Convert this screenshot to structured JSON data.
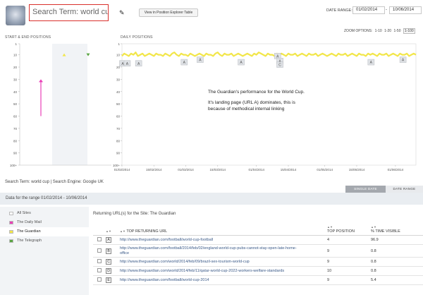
{
  "header": {
    "search_term": "Search Term: world cup",
    "explorer_button": "View in Position Explorer Table",
    "date_range_label": "DATE RANGE:",
    "date_from": "01/02/2014",
    "date_to": "10/06/2014",
    "date_separator": "-"
  },
  "zoom": {
    "label": "ZOOM OPTIONS:",
    "options": [
      "1-10",
      "1-20",
      "1-50",
      "1-100"
    ],
    "active_option": "1-100"
  },
  "panels": {
    "left_title": "START & END POSITIONS",
    "main_title": "DAILY POSITIONS"
  },
  "chart_data": [
    {
      "type": "scatter",
      "title": "START & END POSITIONS",
      "yticks": [
        "1",
        "10",
        "20",
        "30",
        "40",
        "50",
        "60",
        "70",
        "80",
        "90",
        "100+"
      ],
      "ylim": [
        1,
        100
      ],
      "y_inverted": true,
      "points": [
        {
          "series": "start",
          "y": 10,
          "color": "#f2e64a",
          "shape": "up-triangle"
        },
        {
          "series": "end",
          "y": 10,
          "color": "#5aa543",
          "shape": "down-triangle"
        }
      ],
      "movement": {
        "from": 60,
        "to": 30,
        "color": "#e93fb6"
      }
    },
    {
      "type": "line",
      "title": "DAILY POSITIONS",
      "yticks": [
        "1",
        "10",
        "20",
        "30",
        "40",
        "50",
        "60",
        "70",
        "80",
        "90",
        "100+"
      ],
      "ylim": [
        1,
        100
      ],
      "y_inverted": true,
      "xticks": [
        "01/02/2014",
        "15/02/2014",
        "01/03/2014",
        "15/03/2014",
        "01/04/2014",
        "15/04/2014",
        "01/05/2014",
        "15/05/2014",
        "01/06/2014"
      ],
      "x_range": [
        "01/02/2014",
        "10/06/2014"
      ],
      "series": [
        {
          "color": "#f2e64a",
          "values": [
            11,
            9,
            10,
            11,
            9,
            10,
            8,
            11,
            10,
            9,
            11,
            10,
            9,
            10,
            11,
            9,
            10,
            10,
            11,
            9,
            10,
            11,
            9,
            8,
            10,
            11,
            9,
            10,
            10,
            11,
            9,
            10,
            11,
            10,
            9,
            10,
            11,
            9,
            10,
            10,
            11,
            9,
            8,
            10,
            11,
            9,
            10,
            10,
            9,
            11,
            10,
            9,
            10,
            11,
            10,
            9,
            10,
            11,
            9,
            10,
            8,
            9,
            10,
            11,
            9,
            10,
            10,
            11,
            9,
            10,
            9,
            10,
            11,
            9,
            10,
            10,
            9,
            11,
            10,
            9,
            10,
            11,
            9,
            10,
            10,
            9,
            11,
            10,
            9,
            10,
            11,
            10,
            9,
            10,
            11,
            9,
            10,
            10,
            9,
            11,
            10,
            9,
            10,
            11,
            9,
            10,
            10,
            11,
            9,
            10,
            9,
            10,
            11,
            9,
            10,
            10,
            9,
            11,
            10,
            9,
            10,
            11,
            9,
            10,
            10,
            9,
            11,
            10,
            9,
            10
          ]
        }
      ],
      "markers": [
        {
          "label": "A",
          "date": "01/02/2014",
          "y": 17
        },
        {
          "label": "A",
          "date": "03/02/2014",
          "y": 17
        },
        {
          "label": "A",
          "date": "08/02/2014",
          "y": 17
        },
        {
          "label": "A",
          "date": "28/02/2014",
          "y": 16
        },
        {
          "label": "A",
          "date": "07/03/2014",
          "y": 14
        },
        {
          "label": "A",
          "date": "25/03/2014",
          "y": 16
        },
        {
          "label": "A",
          "date": "10/04/2014",
          "y": 11
        },
        {
          "label": "A",
          "date": "11/04/2014",
          "y": 15
        },
        {
          "label": "C",
          "date": "11/04/2014",
          "y": 18
        },
        {
          "label": "A",
          "date": "21/05/2014",
          "y": 16
        },
        {
          "label": "A",
          "date": "04/06/2014",
          "y": 14
        }
      ]
    }
  ],
  "annotation": {
    "line1": "The Guardian's performance for the World Cup.",
    "line2": "It's landing page (URL A) dominates, this is",
    "line3": "because of methodical internal linking"
  },
  "search_info": "Search Term: world cup | Search Engine: Google UK",
  "tabs": {
    "single_date": "SINGLE DATE",
    "date_range": "DATE RANGE"
  },
  "range_text": "Data for the range 01/02/2014 - 10/06/2014",
  "sites": [
    {
      "label": "All Sites",
      "color": "#ffffff",
      "selected": false
    },
    {
      "label": "The Daily Mail",
      "color": "#e93fb6",
      "selected": false
    },
    {
      "label": "The Guardian",
      "color": "#f2e64a",
      "selected": true
    },
    {
      "label": "The Telegraph",
      "color": "#5aa543",
      "selected": false
    }
  ],
  "returning_title": "Returning URL(s) for the Site: The Guardian",
  "table": {
    "columns": [
      "TOP RETURNING URL",
      "TOP POSITION",
      "% TIME VISIBLE"
    ],
    "rows": [
      {
        "letter": "A",
        "url": "http://www.theguardian.com/football/world-cup-football",
        "url2": "",
        "position": "4",
        "visible": "96.9"
      },
      {
        "letter": "B",
        "url": "http://www.theguardian.com/football/2014/feb/02/england-world-cup-pubs-cannot-stay-open-late-home-",
        "url2": "office",
        "position": "9",
        "visible": "0.8"
      },
      {
        "letter": "C",
        "url": "http://www.theguardian.com/world/2014/feb/09/brazil-sex-tourism-world-cup",
        "url2": "",
        "position": "9",
        "visible": "0.8"
      },
      {
        "letter": "D",
        "url": "http://www.theguardian.com/world/2014/feb/11/qatar-world-cup-2022-workers-welfare-standards",
        "url2": "",
        "position": "10",
        "visible": "0.8"
      },
      {
        "letter": "E",
        "url": "http://www.theguardian.com/football/world-cup-2014",
        "url2": "",
        "position": "9",
        "visible": "5.4"
      }
    ]
  }
}
